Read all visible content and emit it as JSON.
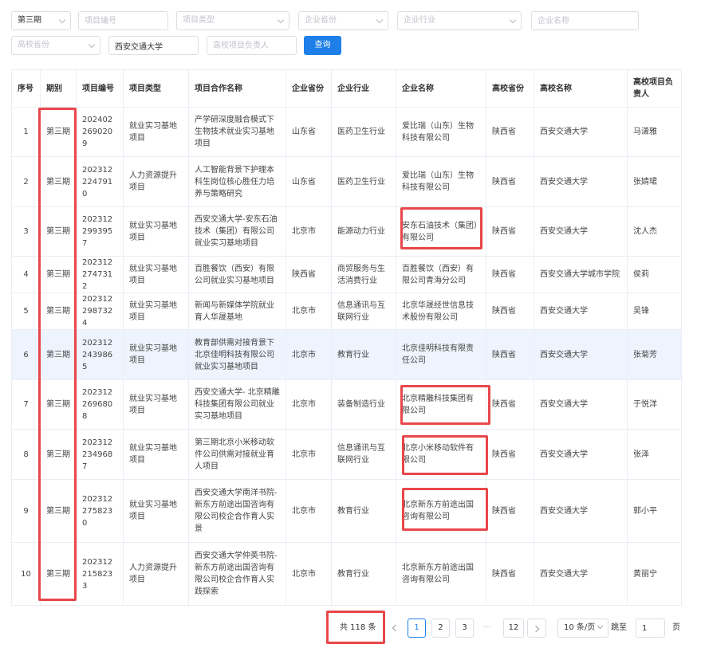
{
  "filters": {
    "period_value": "第三期",
    "project_no_placeholder": "项目编号",
    "project_type_placeholder": "项目类型",
    "enterprise_province_placeholder": "企业省份",
    "enterprise_industry_placeholder": "企业行业",
    "enterprise_name_placeholder": "企业名称",
    "school_province_placeholder": "高校省份",
    "school_name_value": "西安交通大学",
    "school_leader_placeholder": "高校项目负责人",
    "query_label": "查询"
  },
  "table": {
    "headers": [
      "序号",
      "期别",
      "项目编号",
      "项目类型",
      "项目合作名称",
      "企业省份",
      "企业行业",
      "企业名称",
      "高校省份",
      "高校名称",
      "高校项目负责人"
    ],
    "rows": [
      [
        "1",
        "第三期",
        "2024022690209",
        "就业实习基地项目",
        "产学研深度融合模式下生物技术就业实习基地项目",
        "山东省",
        "医药卫生行业",
        "爱比瑞（山东）生物科技有限公司",
        "陕西省",
        "西安交通大学",
        "马潇雅"
      ],
      [
        "2",
        "第三期",
        "2023122247910",
        "人力资源提升项目",
        "人工智能背景下护理本科生岗位核心胜任力培养与策略研究",
        "山东省",
        "医药卫生行业",
        "爱比瑞（山东）生物科技有限公司",
        "陕西省",
        "西安交通大学",
        "张婧珺"
      ],
      [
        "3",
        "第三期",
        "2023122993957",
        "就业实习基地项目",
        "西安交通大学-安东石油技术（集团）有限公司就业实习基地项目",
        "北京市",
        "能源动力行业",
        "安东石油技术（集团）有限公司",
        "陕西省",
        "西安交通大学",
        "沈人杰"
      ],
      [
        "4",
        "第三期",
        "2023122747312",
        "就业实习基地项目",
        "百胜餐饮（西安）有限公司就业实习基地项目",
        "陕西省",
        "商贸服务与生活消费行业",
        "百胜餐饮（西安）有限公司青海分公司",
        "陕西省",
        "西安交通大学城市学院",
        "侯莉"
      ],
      [
        "5",
        "第三期",
        "2023122987324",
        "就业实习基地项目",
        "新闻与新媒体学院就业育人华晟基地",
        "北京市",
        "信息通讯与互联网行业",
        "北京华晟经世信息技术股份有限公司",
        "陕西省",
        "西安交通大学",
        "吴锋"
      ],
      [
        "6",
        "第三期",
        "2023122439865",
        "就业实习基地项目",
        "教育部供需对接背景下北京佳明科技有限公司就业实习基地项目",
        "北京市",
        "教育行业",
        "北京佳明科技有限责任公司",
        "陕西省",
        "西安交通大学",
        "张菊芳"
      ],
      [
        "7",
        "第三期",
        "2023122696808",
        "就业实习基地项目",
        "西安交通大学- 北京精雕科技集团有限公司就业实习基地项目",
        "北京市",
        "装备制造行业",
        "北京精雕科技集团有限公司",
        "陕西省",
        "西安交通大学",
        "于悦洋"
      ],
      [
        "8",
        "第三期",
        "2023122349687",
        "就业实习基地项目",
        "第三期北京小米移动软件公司供需对接就业育人项目",
        "北京市",
        "信息通讯与互联网行业",
        "北京小米移动软件有限公司",
        "陕西省",
        "西安交通大学",
        "张泽"
      ],
      [
        "9",
        "第三期",
        "2023122758230",
        "就业实习基地项目",
        "西安交通大学南洋书院-新东方前途出国咨询有限公司校企合作育人实景",
        "北京市",
        "教育行业",
        "北京新东方前途出国咨询有限公司",
        "陕西省",
        "西安交通大学",
        "郭小平"
      ],
      [
        "10",
        "第三期",
        "2023122158233",
        "人力资源提升项目",
        "西安交通大学仲英书院-新东方前途出国咨询有限公司校企合作育人实践探索",
        "北京市",
        "教育行业",
        "北京新东方前途出国咨询有限公司",
        "陕西省",
        "西安交通大学",
        "黄丽宁"
      ]
    ]
  },
  "pagination": {
    "total_text": "共 118 条",
    "pages": [
      "1",
      "2",
      "3"
    ],
    "ellipsis": "···",
    "last_page": "12",
    "page_size": "10 条/页",
    "goto_label": "跳至",
    "goto_value": "1",
    "page_suffix": "页"
  },
  "colors": {
    "accent": "#1e7fe8",
    "highlight_box": "#e8474b",
    "hover_row": "#eef4fd"
  }
}
